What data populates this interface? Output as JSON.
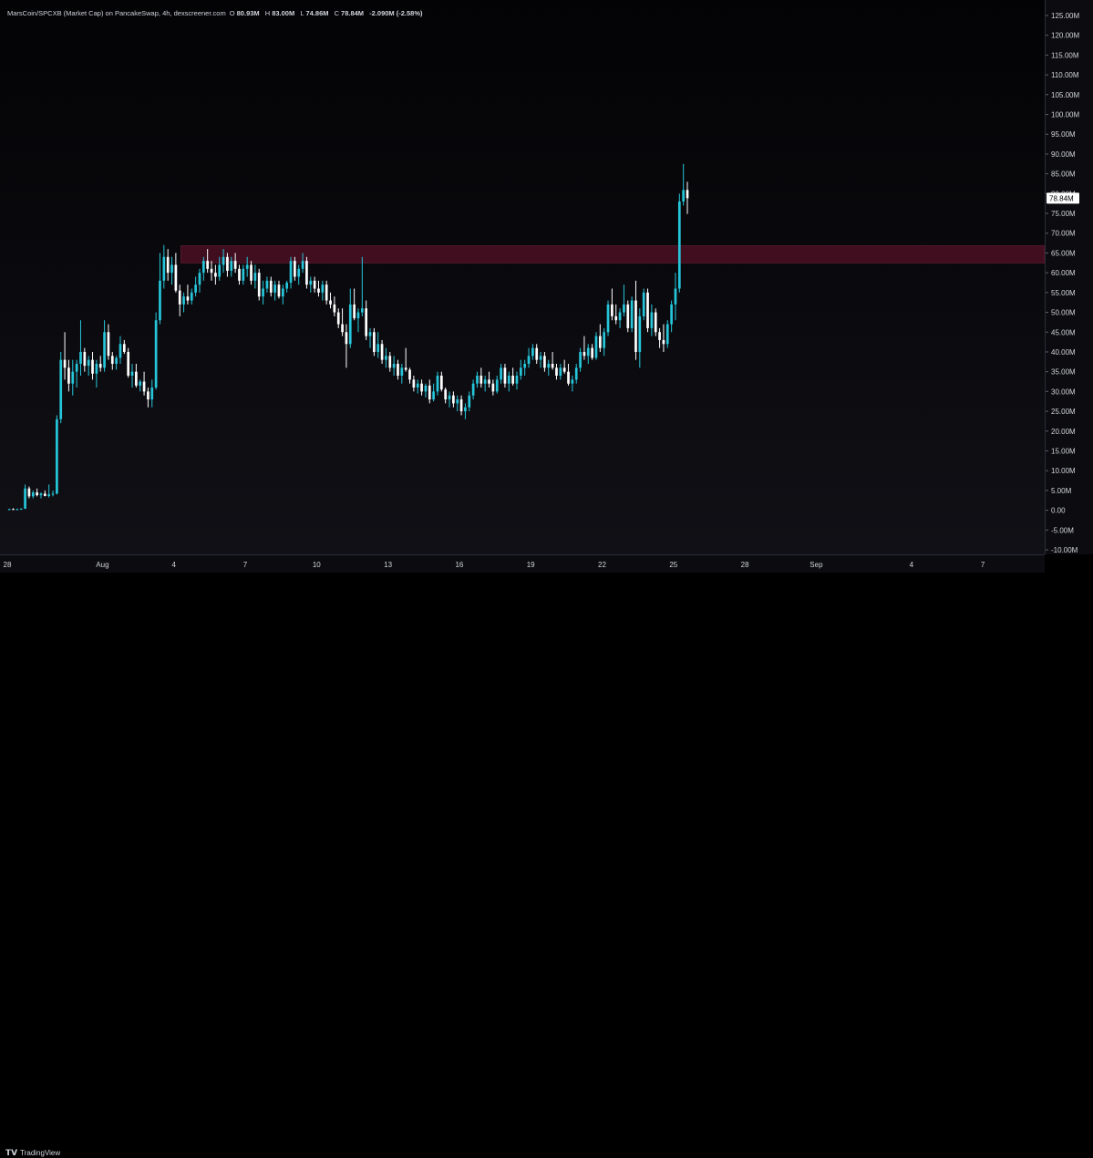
{
  "legend": {
    "title": "MarsCoin/SPCXB (Market Cap) on PancakeSwap, 4h, dexscreener.com",
    "o_label": "O",
    "o_value": "80.93M",
    "h_label": "H",
    "h_value": "83.00M",
    "l_label": "L",
    "l_value": "74.86M",
    "c_label": "C",
    "c_value": "78.84M",
    "change": "-2.090M (-2.58%)"
  },
  "last_price_label": "78.84M",
  "footer": {
    "brand": "TradingView"
  },
  "colors": {
    "up": "#26c6da",
    "down": "#ffffff",
    "zone": "#4a0f23",
    "background": "#000000",
    "axis_text": "#d1d4dc"
  },
  "chart_data": {
    "type": "candlestick",
    "timeframe": "4h",
    "y_unit": "M",
    "ylim": [
      -10,
      127
    ],
    "y_ticks": [
      "125.00M",
      "120.00M",
      "115.00M",
      "110.00M",
      "105.00M",
      "100.00M",
      "95.00M",
      "90.00M",
      "85.00M",
      "80.00M",
      "75.00M",
      "70.00M",
      "65.00M",
      "60.00M",
      "55.00M",
      "50.00M",
      "45.00M",
      "40.00M",
      "35.00M",
      "30.00M",
      "25.00M",
      "20.00M",
      "15.00M",
      "10.00M",
      "5.00M",
      "0.00",
      "-5.00M",
      "-10.00M"
    ],
    "y_tick_values": [
      125,
      120,
      115,
      110,
      105,
      100,
      95,
      90,
      85,
      80,
      75,
      70,
      65,
      60,
      55,
      50,
      45,
      40,
      35,
      30,
      25,
      20,
      15,
      10,
      5,
      0,
      -5,
      -10
    ],
    "x_labels": [
      "28",
      "Aug",
      "4",
      "7",
      "10",
      "13",
      "16",
      "19",
      "22",
      "25",
      "28",
      "Sep",
      "4",
      "7"
    ],
    "x_label_day_index": [
      0,
      4,
      7,
      10,
      13,
      16,
      19,
      22,
      25,
      28,
      31,
      34,
      38,
      41
    ],
    "resistance_zone": {
      "from": 62.5,
      "to": 66.8,
      "start_day_index": 7.3
    },
    "candles_per_day": 6,
    "candles": [
      [
        0.2,
        0.4,
        0.0,
        0.3
      ],
      [
        0.3,
        0.5,
        0.1,
        0.2
      ],
      [
        0.2,
        0.4,
        0.0,
        0.3
      ],
      [
        0.3,
        0.5,
        0.1,
        0.4
      ],
      [
        0.4,
        6.5,
        0.3,
        5.5
      ],
      [
        5.5,
        6.0,
        3.0,
        3.5
      ],
      [
        3.5,
        5.0,
        3.0,
        4.5
      ],
      [
        4.5,
        5.5,
        3.5,
        3.8
      ],
      [
        3.8,
        4.5,
        3.0,
        4.2
      ],
      [
        4.2,
        5.0,
        3.5,
        3.6
      ],
      [
        3.6,
        6.5,
        3.2,
        4.0
      ],
      [
        4.0,
        5.0,
        3.5,
        4.2
      ],
      [
        4.2,
        24.0,
        4.0,
        23.0
      ],
      [
        23.0,
        40.0,
        22.0,
        38.0
      ],
      [
        38.0,
        45.0,
        33.0,
        36.0
      ],
      [
        36.0,
        38.0,
        30.0,
        32.0
      ],
      [
        32.0,
        38.0,
        29.0,
        35.0
      ],
      [
        35.0,
        38.0,
        31.0,
        37.0
      ],
      [
        37.0,
        48.0,
        34.0,
        40.0
      ],
      [
        40.0,
        41.0,
        35.0,
        36.5
      ],
      [
        36.5,
        39.0,
        34.0,
        38.0
      ],
      [
        38.0,
        40.0,
        33.0,
        34.5
      ],
      [
        34.5,
        38.0,
        31.0,
        37.0
      ],
      [
        37.0,
        39.0,
        35.0,
        36.0
      ],
      [
        36.0,
        48.0,
        35.0,
        45.0
      ],
      [
        45.0,
        47.0,
        38.0,
        39.0
      ],
      [
        39.0,
        40.0,
        35.5,
        37.0
      ],
      [
        37.0,
        39.0,
        35.5,
        38.5
      ],
      [
        38.5,
        44.0,
        37.0,
        42.0
      ],
      [
        42.0,
        43.0,
        39.5,
        40.0
      ],
      [
        40.0,
        41.0,
        33.5,
        34.0
      ],
      [
        34.0,
        37.0,
        31.0,
        35.0
      ],
      [
        35.0,
        37.0,
        31.0,
        31.5
      ],
      [
        31.5,
        33.0,
        30.0,
        32.5
      ],
      [
        32.5,
        35.0,
        29.0,
        30.0
      ],
      [
        30.0,
        31.0,
        26.0,
        28.0
      ],
      [
        28.0,
        33.0,
        26.0,
        31.0
      ],
      [
        31.0,
        50.0,
        30.5,
        48.0
      ],
      [
        48.0,
        65.0,
        47.0,
        58.0
      ],
      [
        58.0,
        67.0,
        56.0,
        64.0
      ],
      [
        64.0,
        66.0,
        58.0,
        60.0
      ],
      [
        60.0,
        64.0,
        57.0,
        62.0
      ],
      [
        62.0,
        65.0,
        55.0,
        55.5
      ],
      [
        55.5,
        57.0,
        49.0,
        52.0
      ],
      [
        52.0,
        55.0,
        50.0,
        54.0
      ],
      [
        54.0,
        57.0,
        52.0,
        53.0
      ],
      [
        53.0,
        56.0,
        52.0,
        55.0
      ],
      [
        55.0,
        59.0,
        54.0,
        57.0
      ],
      [
        57.0,
        61.0,
        55.0,
        60.0
      ],
      [
        60.0,
        64.0,
        58.0,
        63.0
      ],
      [
        63.0,
        66.0,
        60.0,
        61.0
      ],
      [
        61.0,
        63.0,
        58.0,
        60.0
      ],
      [
        60.0,
        62.0,
        57.0,
        59.0
      ],
      [
        59.0,
        64.0,
        58.0,
        62.0
      ],
      [
        62.0,
        66.0,
        60.0,
        64.0
      ],
      [
        64.0,
        65.0,
        59.0,
        60.5
      ],
      [
        60.5,
        64.0,
        59.0,
        63.0
      ],
      [
        63.0,
        65.0,
        60.0,
        61.0
      ],
      [
        61.0,
        62.0,
        57.0,
        58.0
      ],
      [
        58.0,
        62.0,
        57.0,
        61.0
      ],
      [
        61.0,
        64.0,
        59.0,
        62.0
      ],
      [
        62.0,
        63.0,
        57.0,
        58.0
      ],
      [
        58.0,
        62.0,
        56.0,
        60.0
      ],
      [
        60.0,
        61.0,
        53.0,
        54.0
      ],
      [
        54.0,
        58.0,
        52.0,
        56.0
      ],
      [
        56.0,
        59.0,
        55.0,
        58.0
      ],
      [
        58.0,
        59.0,
        54.0,
        55.0
      ],
      [
        55.0,
        58.0,
        53.0,
        57.0
      ],
      [
        57.0,
        58.0,
        53.5,
        54.0
      ],
      [
        54.0,
        57.0,
        52.0,
        56.0
      ],
      [
        56.0,
        58.0,
        55.0,
        57.5
      ],
      [
        57.5,
        64.0,
        56.0,
        63.0
      ],
      [
        63.0,
        64.0,
        58.0,
        59.0
      ],
      [
        59.0,
        62.0,
        57.0,
        61.0
      ],
      [
        61.0,
        65.0,
        60.0,
        63.0
      ],
      [
        63.0,
        64.0,
        56.0,
        57.0
      ],
      [
        57.0,
        59.0,
        55.0,
        58.0
      ],
      [
        58.0,
        59.0,
        55.0,
        56.0
      ],
      [
        56.0,
        58.0,
        54.0,
        55.0
      ],
      [
        55.0,
        58.0,
        53.0,
        57.0
      ],
      [
        57.0,
        58.0,
        52.0,
        53.0
      ],
      [
        53.0,
        55.0,
        51.0,
        52.0
      ],
      [
        52.0,
        54.0,
        49.0,
        50.0
      ],
      [
        50.0,
        51.0,
        46.0,
        47.0
      ],
      [
        47.0,
        51.0,
        44.0,
        45.0
      ],
      [
        45.0,
        47.0,
        36.0,
        42.0
      ],
      [
        42.0,
        56.0,
        41.0,
        52.0
      ],
      [
        52.0,
        56.0,
        48.0,
        48.5
      ],
      [
        48.5,
        51.0,
        45.0,
        50.0
      ],
      [
        50.0,
        64.0,
        49.0,
        51.0
      ],
      [
        51.0,
        53.0,
        43.0,
        44.0
      ],
      [
        44.0,
        46.0,
        41.0,
        45.0
      ],
      [
        45.0,
        46.0,
        39.0,
        40.0
      ],
      [
        40.0,
        45.0,
        38.5,
        42.0
      ],
      [
        42.0,
        43.0,
        37.0,
        38.0
      ],
      [
        38.0,
        41.0,
        36.0,
        39.0
      ],
      [
        39.0,
        40.0,
        35.0,
        36.0
      ],
      [
        36.0,
        39.0,
        34.0,
        37.0
      ],
      [
        37.0,
        38.0,
        33.0,
        34.0
      ],
      [
        34.0,
        37.0,
        32.0,
        36.0
      ],
      [
        36.0,
        41.0,
        35.0,
        35.5
      ],
      [
        35.5,
        36.0,
        32.0,
        33.0
      ],
      [
        33.0,
        34.0,
        30.0,
        31.0
      ],
      [
        31.0,
        33.0,
        29.5,
        32.0
      ],
      [
        32.0,
        33.0,
        29.0,
        30.0
      ],
      [
        30.0,
        32.0,
        28.5,
        31.5
      ],
      [
        31.5,
        33.0,
        27.0,
        28.0
      ],
      [
        28.0,
        32.0,
        27.5,
        30.0
      ],
      [
        30.0,
        35.0,
        29.0,
        34.0
      ],
      [
        34.0,
        35.0,
        30.0,
        30.5
      ],
      [
        30.5,
        31.0,
        27.0,
        28.0
      ],
      [
        28.0,
        30.0,
        26.0,
        29.0
      ],
      [
        29.0,
        30.0,
        26.0,
        27.0
      ],
      [
        27.0,
        29.0,
        25.0,
        28.0
      ],
      [
        28.0,
        29.0,
        24.0,
        25.0
      ],
      [
        25.0,
        27.0,
        23.0,
        26.0
      ],
      [
        26.0,
        30.0,
        25.0,
        29.0
      ],
      [
        29.0,
        33.0,
        28.0,
        32.0
      ],
      [
        32.0,
        35.0,
        31.0,
        34.0
      ],
      [
        34.0,
        36.0,
        31.0,
        32.0
      ],
      [
        32.0,
        34.0,
        30.0,
        33.0
      ],
      [
        33.0,
        35.0,
        31.0,
        32.0
      ],
      [
        32.0,
        33.0,
        29.0,
        30.0
      ],
      [
        30.0,
        34.0,
        29.5,
        33.0
      ],
      [
        33.0,
        37.0,
        32.0,
        36.0
      ],
      [
        36.0,
        37.0,
        31.0,
        32.0
      ],
      [
        32.0,
        35.0,
        30.0,
        34.0
      ],
      [
        34.0,
        36.0,
        31.5,
        32.0
      ],
      [
        32.0,
        35.0,
        30.5,
        34.0
      ],
      [
        34.0,
        38.0,
        33.0,
        36.0
      ],
      [
        36.0,
        38.0,
        34.0,
        37.0
      ],
      [
        37.0,
        41.0,
        36.0,
        39.0
      ],
      [
        39.0,
        42.0,
        38.0,
        41.0
      ],
      [
        41.0,
        42.0,
        37.0,
        38.0
      ],
      [
        38.0,
        40.0,
        36.0,
        39.0
      ],
      [
        39.0,
        40.0,
        35.0,
        36.0
      ],
      [
        36.0,
        38.0,
        34.0,
        37.0
      ],
      [
        37.0,
        40.0,
        35.5,
        36.0
      ],
      [
        36.0,
        37.0,
        33.0,
        34.0
      ],
      [
        34.0,
        37.0,
        33.0,
        36.0
      ],
      [
        36.0,
        38.0,
        34.5,
        35.0
      ],
      [
        35.0,
        37.0,
        31.5,
        32.0
      ],
      [
        32.0,
        34.0,
        30.0,
        33.0
      ],
      [
        33.0,
        37.0,
        32.0,
        36.0
      ],
      [
        36.0,
        41.0,
        35.0,
        40.0
      ],
      [
        40.0,
        44.0,
        38.0,
        39.0
      ],
      [
        39.0,
        42.0,
        37.0,
        41.0
      ],
      [
        41.0,
        42.0,
        38.0,
        38.5
      ],
      [
        38.5,
        45.0,
        38.0,
        44.0
      ],
      [
        44.0,
        47.0,
        40.0,
        41.0
      ],
      [
        41.0,
        46.0,
        39.0,
        45.0
      ],
      [
        45.0,
        53.0,
        44.0,
        52.0
      ],
      [
        52.0,
        56.0,
        48.0,
        49.0
      ],
      [
        49.0,
        52.0,
        47.0,
        48.0
      ],
      [
        48.0,
        51.0,
        46.0,
        50.0
      ],
      [
        50.0,
        57.0,
        49.0,
        52.0
      ],
      [
        52.0,
        53.0,
        45.0,
        46.0
      ],
      [
        46.0,
        54.0,
        45.0,
        53.0
      ],
      [
        53.0,
        58.0,
        38.0,
        40.0
      ],
      [
        40.0,
        51.0,
        36.0,
        49.0
      ],
      [
        49.0,
        56.0,
        48.0,
        55.0
      ],
      [
        55.0,
        56.0,
        45.0,
        46.0
      ],
      [
        46.0,
        52.0,
        44.0,
        50.0
      ],
      [
        50.0,
        51.0,
        44.0,
        45.0
      ],
      [
        45.0,
        46.0,
        41.0,
        43.0
      ],
      [
        43.0,
        47.0,
        40.0,
        42.0
      ],
      [
        42.0,
        48.0,
        41.0,
        47.0
      ],
      [
        47.0,
        53.0,
        45.0,
        52.0
      ],
      [
        52.0,
        60.0,
        48.0,
        56.0
      ],
      [
        56.0,
        80.0,
        55.0,
        78.0
      ],
      [
        78.0,
        87.5,
        77.0,
        80.9
      ],
      [
        80.93,
        83.0,
        74.86,
        78.84
      ]
    ]
  }
}
